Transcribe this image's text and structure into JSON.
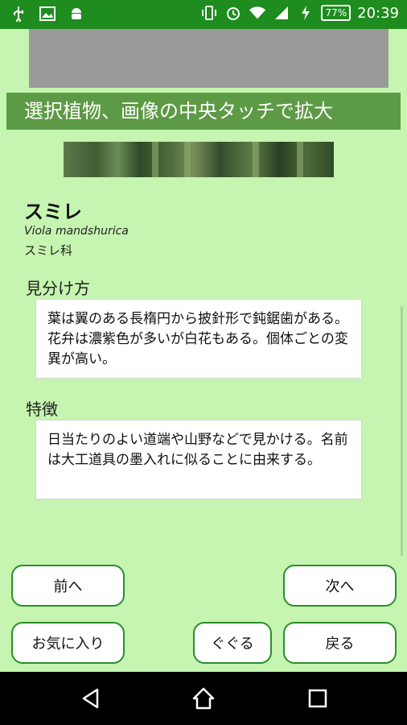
{
  "status_bar": {
    "time": "20:39",
    "battery": "77%",
    "network": "4G",
    "icons": [
      "usb-icon",
      "image-icon",
      "android-icon",
      "vibrate-icon",
      "alarm-icon",
      "wifi-icon",
      "signal-icon",
      "charging-icon",
      "battery-icon"
    ]
  },
  "banner": {
    "text": "選択植物、画像の中央タッチで拡大"
  },
  "plant": {
    "name": "スミレ",
    "latin": "Viola mandshurica",
    "family": "スミレ科"
  },
  "sections": [
    {
      "heading": "見分け方",
      "body": "葉は翼のある長楕円から披針形で鈍鋸歯がある。花弁は濃紫色が多いが白花もある。個体ごとの変異が高い。"
    },
    {
      "heading": "特徴",
      "body": "日当たりのよい道端や山野などで見かける。名前は大工道具の墨入れに似ることに由来する。"
    }
  ],
  "buttons": {
    "prev": "前へ",
    "next": "次へ",
    "favorite": "お気に入り",
    "google": "ぐぐる",
    "back": "戻る"
  },
  "colors": {
    "background": "#c5f5b0",
    "status_bar": "#1e8c1e",
    "banner": "#5d9a45",
    "button_border": "#2a8f2a"
  }
}
